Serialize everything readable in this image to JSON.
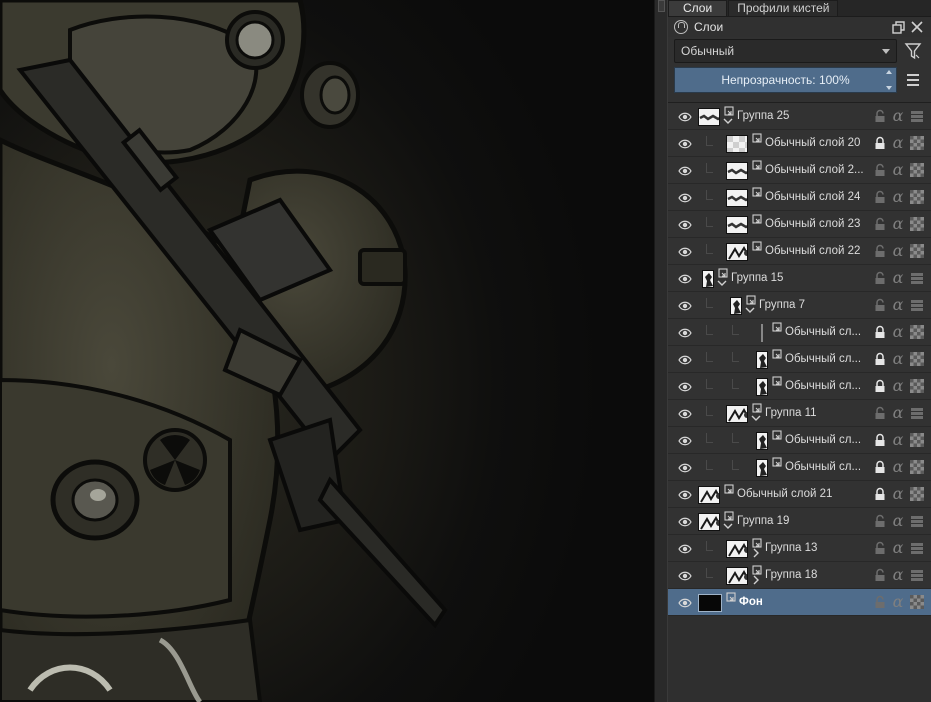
{
  "tabs": [
    {
      "label": "Слои",
      "active": true
    },
    {
      "label": "Профили кистей",
      "active": false
    }
  ],
  "docker": {
    "title": "Слои",
    "blend_mode": "Обычный",
    "opacity_label": "Непрозрачность:",
    "opacity_value": "100%"
  },
  "layers": [
    {
      "name": "Группа 25",
      "depth": 0,
      "group": true,
      "expanded": true,
      "locked": false,
      "thumb": "stripe"
    },
    {
      "name": "Обычный слой 20",
      "depth": 1,
      "group": false,
      "locked": true,
      "thumb": "checker"
    },
    {
      "name": "Обычный слой 2...",
      "depth": 1,
      "group": false,
      "locked": false,
      "thumb": "stripe"
    },
    {
      "name": "Обычный слой 24",
      "depth": 1,
      "group": false,
      "locked": false,
      "thumb": "stripe"
    },
    {
      "name": "Обычный слой 23",
      "depth": 1,
      "group": false,
      "locked": false,
      "thumb": "stripe"
    },
    {
      "name": "Обычный слой 22",
      "depth": 1,
      "group": false,
      "locked": false,
      "thumb": "sketch"
    },
    {
      "name": "Группа 15",
      "depth": 0,
      "group": true,
      "expanded": true,
      "locked": false,
      "thumb": "figure"
    },
    {
      "name": "Группа 7",
      "depth": 1,
      "group": true,
      "expanded": true,
      "locked": false,
      "thumb": "figure"
    },
    {
      "name": "Обычный сл...",
      "depth": 2,
      "group": false,
      "locked": true,
      "thumb": "line"
    },
    {
      "name": "Обычный сл...",
      "depth": 2,
      "group": false,
      "locked": true,
      "thumb": "figure"
    },
    {
      "name": "Обычный сл...",
      "depth": 2,
      "group": false,
      "locked": true,
      "thumb": "figure"
    },
    {
      "name": "Группа 11",
      "depth": 1,
      "group": true,
      "expanded": true,
      "locked": false,
      "thumb": "sketch"
    },
    {
      "name": "Обычный сл...",
      "depth": 2,
      "group": false,
      "locked": true,
      "thumb": "figure"
    },
    {
      "name": "Обычный сл...",
      "depth": 2,
      "group": false,
      "locked": true,
      "thumb": "figure"
    },
    {
      "name": "Обычный слой 21",
      "depth": 0,
      "group": false,
      "locked": true,
      "thumb": "sketch"
    },
    {
      "name": "Группа 19",
      "depth": 0,
      "group": true,
      "expanded": true,
      "locked": false,
      "thumb": "sketch"
    },
    {
      "name": "Группа 13",
      "depth": 1,
      "group": true,
      "expanded": false,
      "locked": false,
      "thumb": "sketch"
    },
    {
      "name": "Группа 18",
      "depth": 1,
      "group": true,
      "expanded": false,
      "locked": false,
      "thumb": "sketch"
    },
    {
      "name": "Фон",
      "depth": 0,
      "group": false,
      "locked": false,
      "thumb": "dark",
      "selected": true
    }
  ],
  "colors": {
    "selection": "#4f6c8b",
    "panel": "#313131",
    "canvas_bg": "#0b0b0b"
  },
  "icons": [
    "layers-icon",
    "float-icon",
    "close-icon",
    "filter-icon",
    "menu-icon",
    "eye-icon",
    "lock-icon",
    "alpha-icon",
    "inherit-alpha-icon",
    "layer-type-icon",
    "chevron-icon"
  ]
}
